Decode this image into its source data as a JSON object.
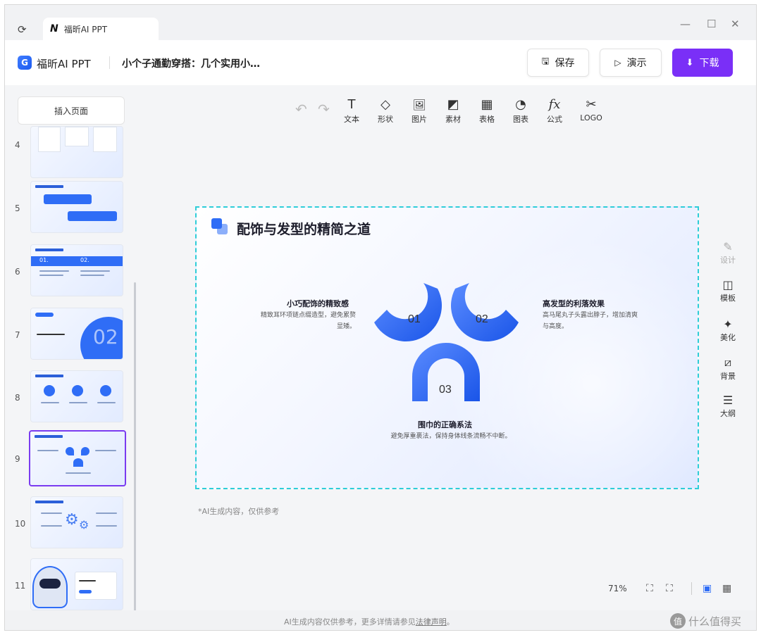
{
  "tab": {
    "title": "福昕AI PPT",
    "logo": "N"
  },
  "window_controls": {
    "minimize": "—",
    "maximize": "☐",
    "close": "✕"
  },
  "header": {
    "app_name": "福昕AI PPT",
    "doc_title": "小个子通勤穿搭：几个实用小…",
    "save_label": "保存",
    "present_label": "演示",
    "download_label": "下载"
  },
  "sidebar": {
    "insert_label": "插入页面",
    "pages": [
      "4",
      "5",
      "6",
      "7",
      "8",
      "9",
      "10",
      "11"
    ],
    "selected_page": "9",
    "thumb_texts": {
      "p6_a": "01.",
      "p6_b": "02.",
      "p7_big": "02"
    }
  },
  "toolbar": {
    "undo_icon": "↶",
    "redo_icon": "↷",
    "tools": [
      {
        "icon": "T",
        "label": "文本"
      },
      {
        "icon": "◇",
        "label": "形状"
      },
      {
        "icon": "🖼",
        "label": "图片"
      },
      {
        "icon": "◩",
        "label": "素材"
      },
      {
        "icon": "▦",
        "label": "表格"
      },
      {
        "icon": "◔",
        "label": "图表"
      },
      {
        "icon": "fx",
        "label": "公式"
      },
      {
        "icon": "✂",
        "label": "LOGO"
      }
    ]
  },
  "slide": {
    "title": "配饰与发型的精简之道",
    "point1": {
      "number": "01",
      "heading": "小巧配饰的精致感",
      "body_l1": "精致耳环项链点缀造型，避免累赘",
      "body_l2": "显矮。"
    },
    "point2": {
      "number": "02",
      "heading": "高发型的利落效果",
      "body_l1": "高马尾丸子头露出脖子，增加清爽",
      "body_l2": "与高度。"
    },
    "point3": {
      "number": "03",
      "heading": "围巾的正确系法",
      "body_l1": "避免厚重裹法，保持身体线条流畅不中断。"
    }
  },
  "canvas": {
    "ai_note": "*AI生成内容，仅供参考"
  },
  "rail": [
    {
      "icon": "✎",
      "label": "设计",
      "disabled": true
    },
    {
      "icon": "◫",
      "label": "模板",
      "disabled": false
    },
    {
      "icon": "✦",
      "label": "美化",
      "disabled": false
    },
    {
      "icon": "⧄",
      "label": "背景",
      "disabled": false
    },
    {
      "icon": "☰",
      "label": "大纲",
      "disabled": false
    }
  ],
  "controls": {
    "zoom": "71%",
    "fit_icon": "⛶",
    "full_icon": "⛶",
    "single_view_icon": "▣",
    "grid_view_icon": "▦"
  },
  "footer": {
    "text_before": "AI生成内容仅供参考，更多详情请参见",
    "link": "法律声明",
    "text_after": "。",
    "watermark_icon": "值",
    "watermark": "什么值得买"
  },
  "colors": {
    "accent": "#7a2ff7",
    "slide_blue": "#2f6df6",
    "selection": "#2ecdd8"
  }
}
